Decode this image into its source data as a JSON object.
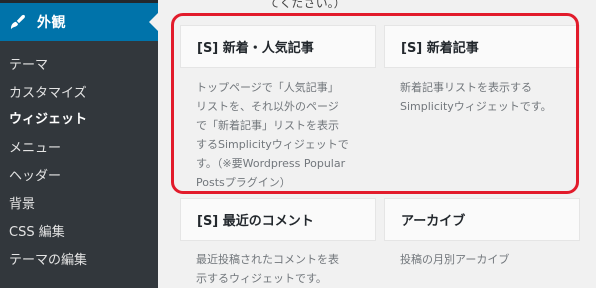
{
  "sidebar": {
    "menu_title": "外観",
    "menu_icon": "brush-icon",
    "items": [
      {
        "label": "テーマ",
        "current": false
      },
      {
        "label": "カスタマイズ",
        "current": false
      },
      {
        "label": "ウィジェット",
        "current": true
      },
      {
        "label": "メニュー",
        "current": false
      },
      {
        "label": "ヘッダー",
        "current": false
      },
      {
        "label": "背景",
        "current": false
      },
      {
        "label": "CSS 編集",
        "current": false
      },
      {
        "label": "テーマの編集",
        "current": false
      }
    ]
  },
  "hint_text": "てください。）",
  "widgets": [
    {
      "title": "[S] 新着・人気記事",
      "description": [
        "トップページで「人気記事」",
        "リストを、それ以外のページ",
        "で「新着記事」リストを表示",
        "するSimplicityウィジェットで",
        "す。（※要Wordpress Popular",
        "Postsプラグイン）"
      ]
    },
    {
      "title": "[S] 新着記事",
      "description": [
        "新着記事リストを表示する",
        "Simplicityウィジェットです。"
      ]
    },
    {
      "title": "[S] 最近のコメント",
      "description": [
        "最近投稿されたコメントを表",
        "示するウィジェットです。"
      ]
    },
    {
      "title": "アーカイブ",
      "description": [
        "投稿の月別アーカイブ"
      ]
    }
  ],
  "colors": {
    "sidebar_bg": "#23282d",
    "submenu_bg": "#32373c",
    "active_menu_bg": "#0073aa",
    "highlight_border": "#e21b2b"
  }
}
